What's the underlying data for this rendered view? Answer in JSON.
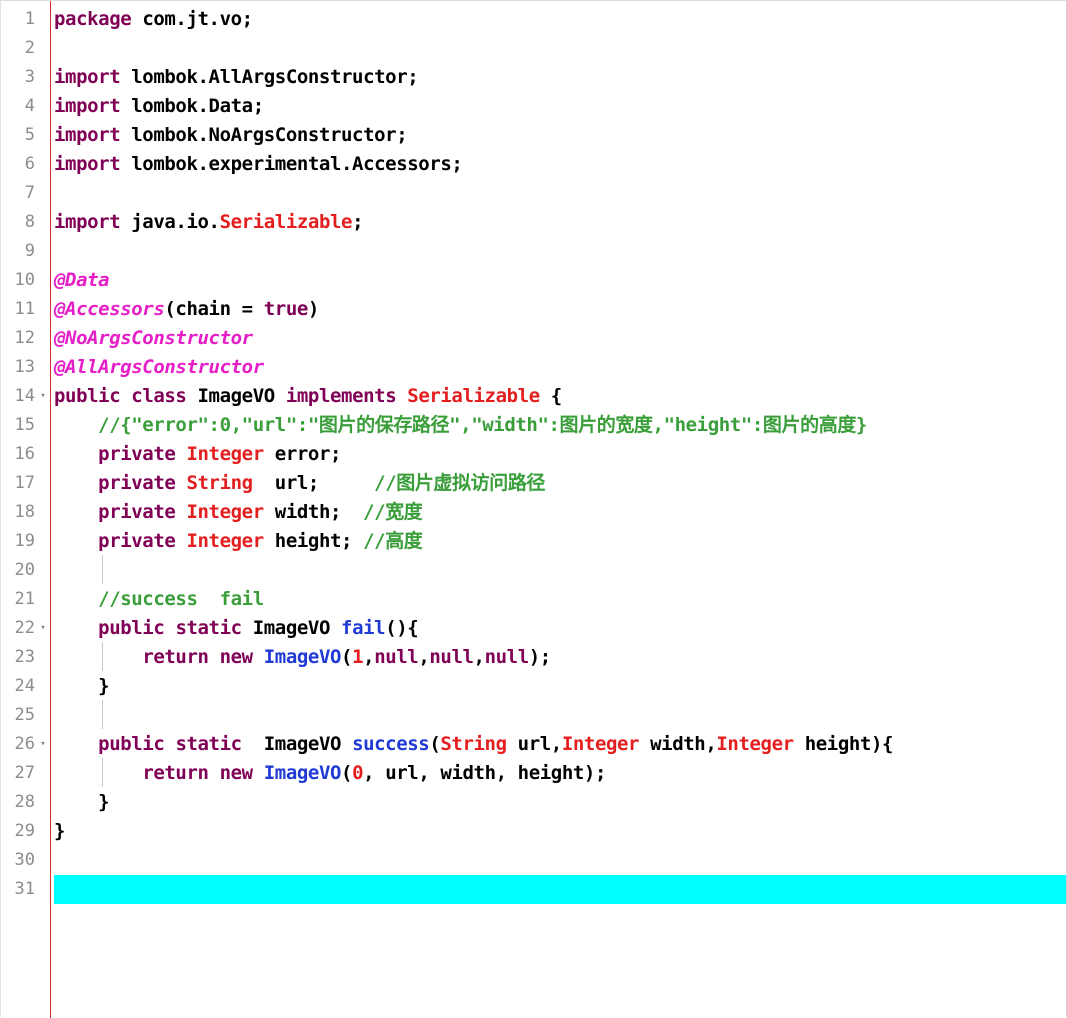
{
  "editor": {
    "lines": [
      {
        "n": "1",
        "tokens": [
          {
            "t": "package",
            "c": "kw"
          },
          {
            "t": " com.jt.vo;",
            "c": ""
          }
        ]
      },
      {
        "n": "2",
        "tokens": []
      },
      {
        "n": "3",
        "tokens": [
          {
            "t": "import",
            "c": "kw"
          },
          {
            "t": " lombok.AllArgsConstructor;",
            "c": ""
          }
        ]
      },
      {
        "n": "4",
        "tokens": [
          {
            "t": "import",
            "c": "kw"
          },
          {
            "t": " lombok.Data;",
            "c": ""
          }
        ]
      },
      {
        "n": "5",
        "tokens": [
          {
            "t": "import",
            "c": "kw"
          },
          {
            "t": " lombok.NoArgsConstructor;",
            "c": ""
          }
        ]
      },
      {
        "n": "6",
        "tokens": [
          {
            "t": "import",
            "c": "kw"
          },
          {
            "t": " lombok.experimental.Accessors;",
            "c": ""
          }
        ]
      },
      {
        "n": "7",
        "tokens": []
      },
      {
        "n": "8",
        "tokens": [
          {
            "t": "import",
            "c": "kw"
          },
          {
            "t": " java.io.",
            "c": ""
          },
          {
            "t": "Serializable",
            "c": "ty"
          },
          {
            "t": ";",
            "c": ""
          }
        ]
      },
      {
        "n": "9",
        "tokens": []
      },
      {
        "n": "10",
        "tokens": [
          {
            "t": "@Data",
            "c": "an"
          }
        ]
      },
      {
        "n": "11",
        "tokens": [
          {
            "t": "@Accessors",
            "c": "an"
          },
          {
            "t": "(chain = ",
            "c": ""
          },
          {
            "t": "true",
            "c": "kw"
          },
          {
            "t": ")",
            "c": ""
          }
        ]
      },
      {
        "n": "12",
        "tokens": [
          {
            "t": "@NoArgsConstructor",
            "c": "an"
          }
        ]
      },
      {
        "n": "13",
        "tokens": [
          {
            "t": "@AllArgsConstructor",
            "c": "an"
          }
        ]
      },
      {
        "n": "14",
        "fold": true,
        "tokens": [
          {
            "t": "public",
            "c": "kw"
          },
          {
            "t": " ",
            "c": ""
          },
          {
            "t": "class",
            "c": "kw"
          },
          {
            "t": " ImageVO ",
            "c": ""
          },
          {
            "t": "implements",
            "c": "kw"
          },
          {
            "t": " ",
            "c": ""
          },
          {
            "t": "Serializable",
            "c": "ty"
          },
          {
            "t": " {",
            "c": ""
          }
        ]
      },
      {
        "n": "15",
        "tokens": [
          {
            "t": "    ",
            "c": ""
          },
          {
            "t": "//{\"error\":0,\"url\":\"图片的保存路径\",\"width\":图片的宽度,\"height\":图片的高度}",
            "c": "cm"
          }
        ]
      },
      {
        "n": "16",
        "tokens": [
          {
            "t": "    ",
            "c": ""
          },
          {
            "t": "private",
            "c": "kw"
          },
          {
            "t": " ",
            "c": ""
          },
          {
            "t": "Integer",
            "c": "ty"
          },
          {
            "t": " error;",
            "c": ""
          }
        ]
      },
      {
        "n": "17",
        "tokens": [
          {
            "t": "    ",
            "c": ""
          },
          {
            "t": "private",
            "c": "kw"
          },
          {
            "t": " ",
            "c": ""
          },
          {
            "t": "String",
            "c": "ty"
          },
          {
            "t": "  url;     ",
            "c": ""
          },
          {
            "t": "//图片虚拟访问路径",
            "c": "cm"
          }
        ]
      },
      {
        "n": "18",
        "tokens": [
          {
            "t": "    ",
            "c": ""
          },
          {
            "t": "private",
            "c": "kw"
          },
          {
            "t": " ",
            "c": ""
          },
          {
            "t": "Integer",
            "c": "ty"
          },
          {
            "t": " width;  ",
            "c": ""
          },
          {
            "t": "//宽度",
            "c": "cm"
          }
        ]
      },
      {
        "n": "19",
        "tokens": [
          {
            "t": "    ",
            "c": ""
          },
          {
            "t": "private",
            "c": "kw"
          },
          {
            "t": " ",
            "c": ""
          },
          {
            "t": "Integer",
            "c": "ty"
          },
          {
            "t": " height; ",
            "c": ""
          },
          {
            "t": "//高度",
            "c": "cm"
          }
        ]
      },
      {
        "n": "20",
        "tokens": []
      },
      {
        "n": "21",
        "tokens": [
          {
            "t": "    ",
            "c": ""
          },
          {
            "t": "//success  fail",
            "c": "cm"
          }
        ]
      },
      {
        "n": "22",
        "fold": true,
        "tokens": [
          {
            "t": "    ",
            "c": ""
          },
          {
            "t": "public",
            "c": "kw"
          },
          {
            "t": " ",
            "c": ""
          },
          {
            "t": "static",
            "c": "kw"
          },
          {
            "t": " ImageVO ",
            "c": ""
          },
          {
            "t": "fail",
            "c": "mt"
          },
          {
            "t": "(){",
            "c": ""
          }
        ]
      },
      {
        "n": "23",
        "tokens": [
          {
            "t": "        ",
            "c": ""
          },
          {
            "t": "return",
            "c": "kw"
          },
          {
            "t": " ",
            "c": ""
          },
          {
            "t": "new",
            "c": "kw"
          },
          {
            "t": " ",
            "c": ""
          },
          {
            "t": "ImageVO",
            "c": "mt"
          },
          {
            "t": "(",
            "c": ""
          },
          {
            "t": "1",
            "c": "nm"
          },
          {
            "t": ",",
            "c": ""
          },
          {
            "t": "null",
            "c": "kw"
          },
          {
            "t": ",",
            "c": ""
          },
          {
            "t": "null",
            "c": "kw"
          },
          {
            "t": ",",
            "c": ""
          },
          {
            "t": "null",
            "c": "kw"
          },
          {
            "t": ");",
            "c": ""
          }
        ]
      },
      {
        "n": "24",
        "tokens": [
          {
            "t": "    }",
            "c": ""
          }
        ]
      },
      {
        "n": "25",
        "tokens": []
      },
      {
        "n": "26",
        "fold": true,
        "tokens": [
          {
            "t": "    ",
            "c": ""
          },
          {
            "t": "public",
            "c": "kw"
          },
          {
            "t": " ",
            "c": ""
          },
          {
            "t": "static",
            "c": "kw"
          },
          {
            "t": "  ImageVO ",
            "c": ""
          },
          {
            "t": "success",
            "c": "mt"
          },
          {
            "t": "(",
            "c": ""
          },
          {
            "t": "String",
            "c": "ty"
          },
          {
            "t": " url,",
            "c": ""
          },
          {
            "t": "Integer",
            "c": "ty"
          },
          {
            "t": " width,",
            "c": ""
          },
          {
            "t": "Integer",
            "c": "ty"
          },
          {
            "t": " height){",
            "c": ""
          }
        ]
      },
      {
        "n": "27",
        "tokens": [
          {
            "t": "        ",
            "c": ""
          },
          {
            "t": "return",
            "c": "kw"
          },
          {
            "t": " ",
            "c": ""
          },
          {
            "t": "new",
            "c": "kw"
          },
          {
            "t": " ",
            "c": ""
          },
          {
            "t": "ImageVO",
            "c": "mt"
          },
          {
            "t": "(",
            "c": ""
          },
          {
            "t": "0",
            "c": "nm"
          },
          {
            "t": ", url, width, height);",
            "c": ""
          }
        ]
      },
      {
        "n": "28",
        "tokens": [
          {
            "t": "    }",
            "c": ""
          }
        ]
      },
      {
        "n": "29",
        "tokens": [
          {
            "t": "}",
            "c": ""
          }
        ]
      },
      {
        "n": "30",
        "tokens": []
      },
      {
        "n": "31",
        "current": true,
        "tokens": []
      }
    ]
  },
  "colors": {
    "keyword": "#7f0055",
    "type": "#e41e1e",
    "annotation": "#e61ec8",
    "comment": "#3a9e3a",
    "method": "#1f3ad6",
    "current_line": "#00ffff",
    "margin_line": "#d22f2f",
    "line_number": "#8c8c8c"
  }
}
